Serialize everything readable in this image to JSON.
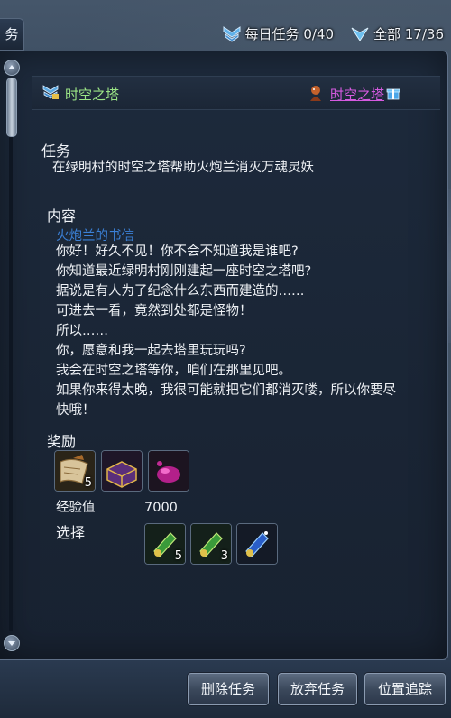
{
  "top_tab_label": "务",
  "top_stats": {
    "daily_label": "每日任务 0/40",
    "all_label": "全部 17/36"
  },
  "quest": {
    "title": "时空之塔",
    "npc_link": "时空之塔"
  },
  "task": {
    "heading": "任务",
    "description": "在绿明村的时空之塔帮助火炮兰消灭万魂灵妖"
  },
  "content": {
    "heading": "内容",
    "letter_title": "火炮兰的书信",
    "lines": [
      "你好！好久不见！你不会不知道我是谁吧?",
      "你知道最近绿明村刚刚建起一座时空之塔吧?",
      "据说是有人为了纪念什么东西而建造的……",
      "可进去一看，竟然到处都是怪物！",
      "所以……",
      "你，愿意和我一起去塔里玩玩吗?",
      "我会在时空之塔等你，咱们在那里见吧。",
      "如果你来得太晚，我很可能就把它们都消灭喽，所以你要尽",
      "快哦！"
    ]
  },
  "rewards": {
    "heading": "奖励",
    "items": [
      {
        "icon": "scroll-icon",
        "count": "5"
      },
      {
        "icon": "treasure-chest-icon",
        "count": ""
      },
      {
        "icon": "pink-gem-icon",
        "count": ""
      }
    ],
    "exp_label": "经验值",
    "exp_value": "7000",
    "choice_label": "选择",
    "choices": [
      {
        "icon": "green-charm-icon",
        "count": "5"
      },
      {
        "icon": "green-charm-icon",
        "count": "3"
      },
      {
        "icon": "blue-charm-icon",
        "count": ""
      }
    ]
  },
  "buttons": {
    "delete": "删除任务",
    "abandon": "放弃任务",
    "track": "位置追踪"
  },
  "colors": {
    "title_green": "#9be486",
    "npc_purple": "#d55ae0",
    "letter_blue": "#3b80d6"
  }
}
